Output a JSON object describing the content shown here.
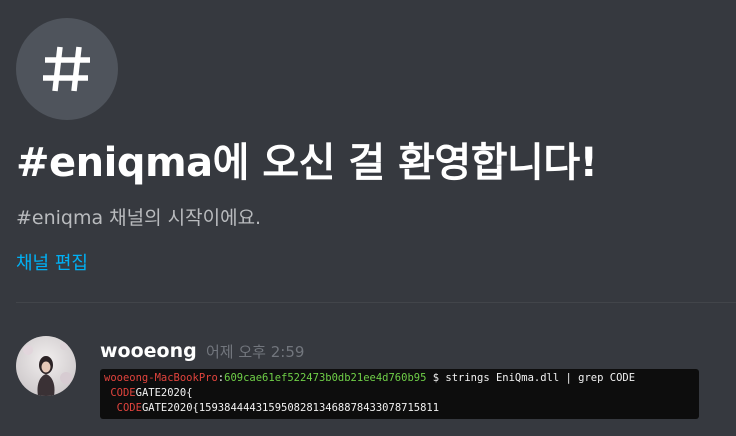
{
  "channel": {
    "icon": "hash-icon",
    "welcome_title": "#eniqma에 오신 걸 환영합니다!",
    "welcome_subtitle": "#eniqma 채널의 시작이에요.",
    "edit_link": "채널 편집"
  },
  "message": {
    "author": "wooeong",
    "timestamp": "어제 오후 2:59",
    "attachment": {
      "prompt_host": "wooeong-MacBookPro",
      "prompt_sep": ":",
      "prompt_path": "609cae61ef522473b0db21ee4d760b95",
      "command": " $ strings EniQma.dll | grep CODE",
      "line1_match": "CODE",
      "line1_rest": "GATE2020{",
      "line2_match": "CODE",
      "line2_rest": "GATE2020{15938444431595082813468878433078715811"
    }
  },
  "colors": {
    "background": "#36393f",
    "link": "#00b0f4",
    "terminal_bg": "#0d0d0d",
    "terminal_red": "#e0433d",
    "terminal_green": "#6fcf48"
  }
}
